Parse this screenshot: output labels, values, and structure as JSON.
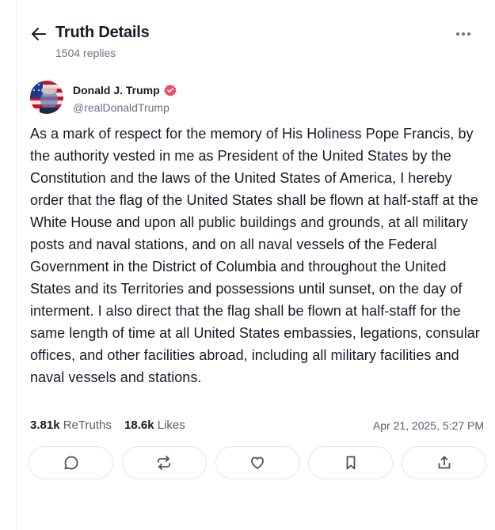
{
  "header": {
    "title": "Truth Details",
    "subtitle": "1504 replies"
  },
  "author": {
    "name": "Donald J. Trump",
    "handle": "@realDonaldTrump",
    "verified": true,
    "verified_color": "#ec4b68"
  },
  "post": {
    "text": "As a mark of respect for the memory of His Holiness Pope Francis, by the authority vested in me as President of the United States by the Constitution and the laws of the United States of America, I hereby order that the flag of the United States shall be flown at half-staff at the White House and upon all public buildings and grounds, at all military posts and naval stations, and on all naval vessels of the Federal Government in the District of Columbia and throughout the United States and its Territories and possessions until sunset, on the day of interment. I also direct that the flag shall be flown at half-staff for the same length of time at all United States embassies, legations, consular offices, and other facilities abroad, including all military facilities and naval vessels and stations."
  },
  "stats": {
    "retruths_count": "3.81k",
    "retruths_label": "ReTruths",
    "likes_count": "18.6k",
    "likes_label": "Likes",
    "timestamp": "Apr 21, 2025, 5:27 PM"
  },
  "actions": [
    {
      "name": "reply",
      "icon": "speech-bubble-icon"
    },
    {
      "name": "retruth",
      "icon": "repost-icon"
    },
    {
      "name": "like",
      "icon": "heart-icon"
    },
    {
      "name": "bookmark",
      "icon": "bookmark-icon"
    },
    {
      "name": "share",
      "icon": "share-icon"
    }
  ],
  "colors": {
    "text": "#161b26",
    "muted": "#6b7280",
    "icon": "#4b5160",
    "border": "#e3e6ea"
  }
}
